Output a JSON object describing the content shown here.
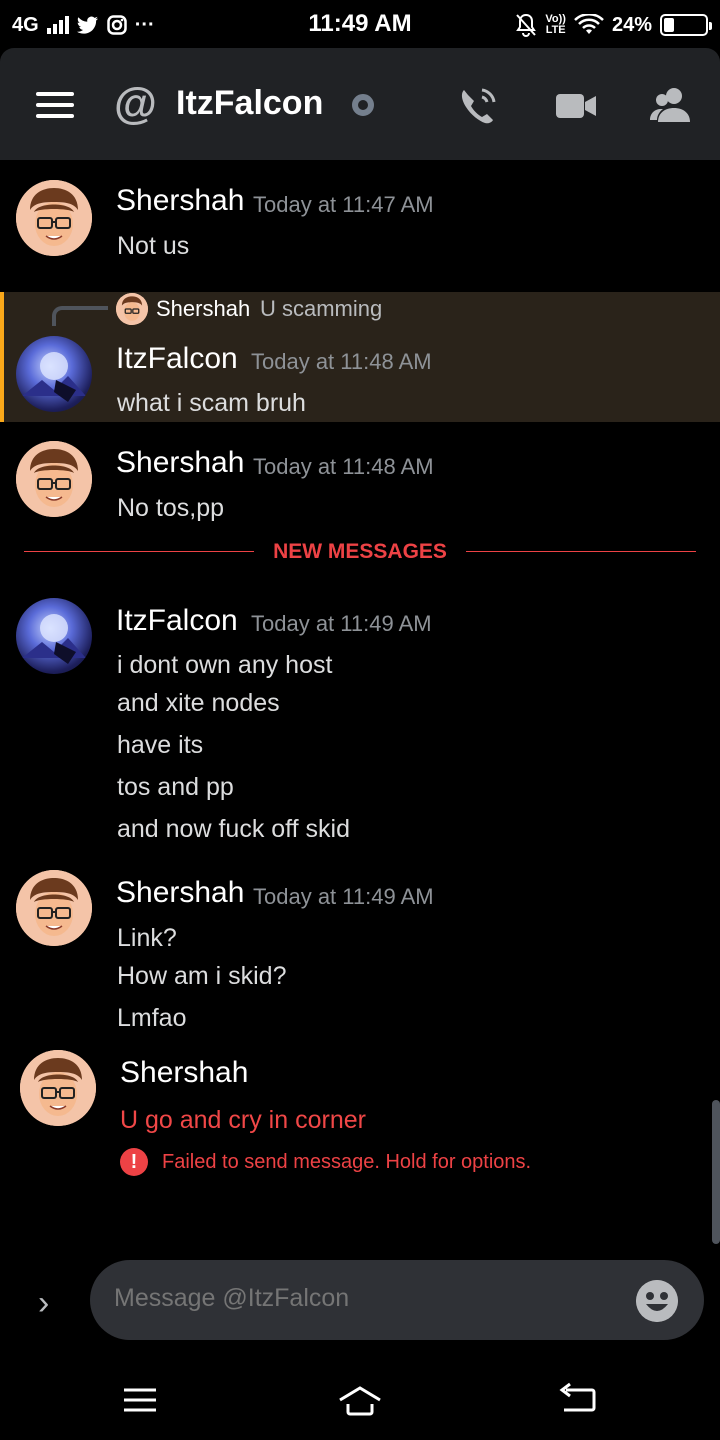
{
  "status_bar": {
    "network": "4G",
    "time": "11:49 AM",
    "lte_top": "Vo))",
    "lte_bottom": "LTE",
    "battery": "24%",
    "battery_level": 0.24,
    "more": "···"
  },
  "header": {
    "at_symbol": "@",
    "channel_name": "ItzFalcon"
  },
  "messages": [
    {
      "author": "Shershah",
      "timestamp": "Today at 11:47 AM",
      "lines": [
        "Not us"
      ]
    },
    {
      "reply_to": {
        "author": "Shershah",
        "text": "U scamming"
      },
      "author": "ItzFalcon",
      "timestamp": "Today at 11:48 AM",
      "lines": [
        "what i scam bruh"
      ]
    },
    {
      "author": "Shershah",
      "timestamp": "Today at 11:48 AM",
      "lines": [
        "No tos,pp"
      ]
    },
    {
      "author": "ItzFalcon",
      "timestamp": "Today at 11:49 AM",
      "lines": [
        "i dont own any host",
        "and xite nodes",
        "have its",
        "tos and pp",
        "and now fuck off skid"
      ]
    },
    {
      "author": "Shershah",
      "timestamp": "Today at 11:49 AM",
      "lines": [
        "Link?",
        "How am i skid?",
        "Lmfao"
      ]
    },
    {
      "author": "Shershah",
      "lines": [
        "U go and cry in corner"
      ],
      "failed_notice": "Failed to send message. Hold for options.",
      "fail_icon": "!"
    }
  ],
  "new_messages_label": "NEW MESSAGES",
  "composer": {
    "expand_glyph": "›",
    "placeholder": "Message @ItzFalcon"
  },
  "colors": {
    "header_bg": "#202225",
    "reply_highlight": "#faa81a",
    "danger": "#ed4245",
    "status_offline": "#747f8d"
  }
}
